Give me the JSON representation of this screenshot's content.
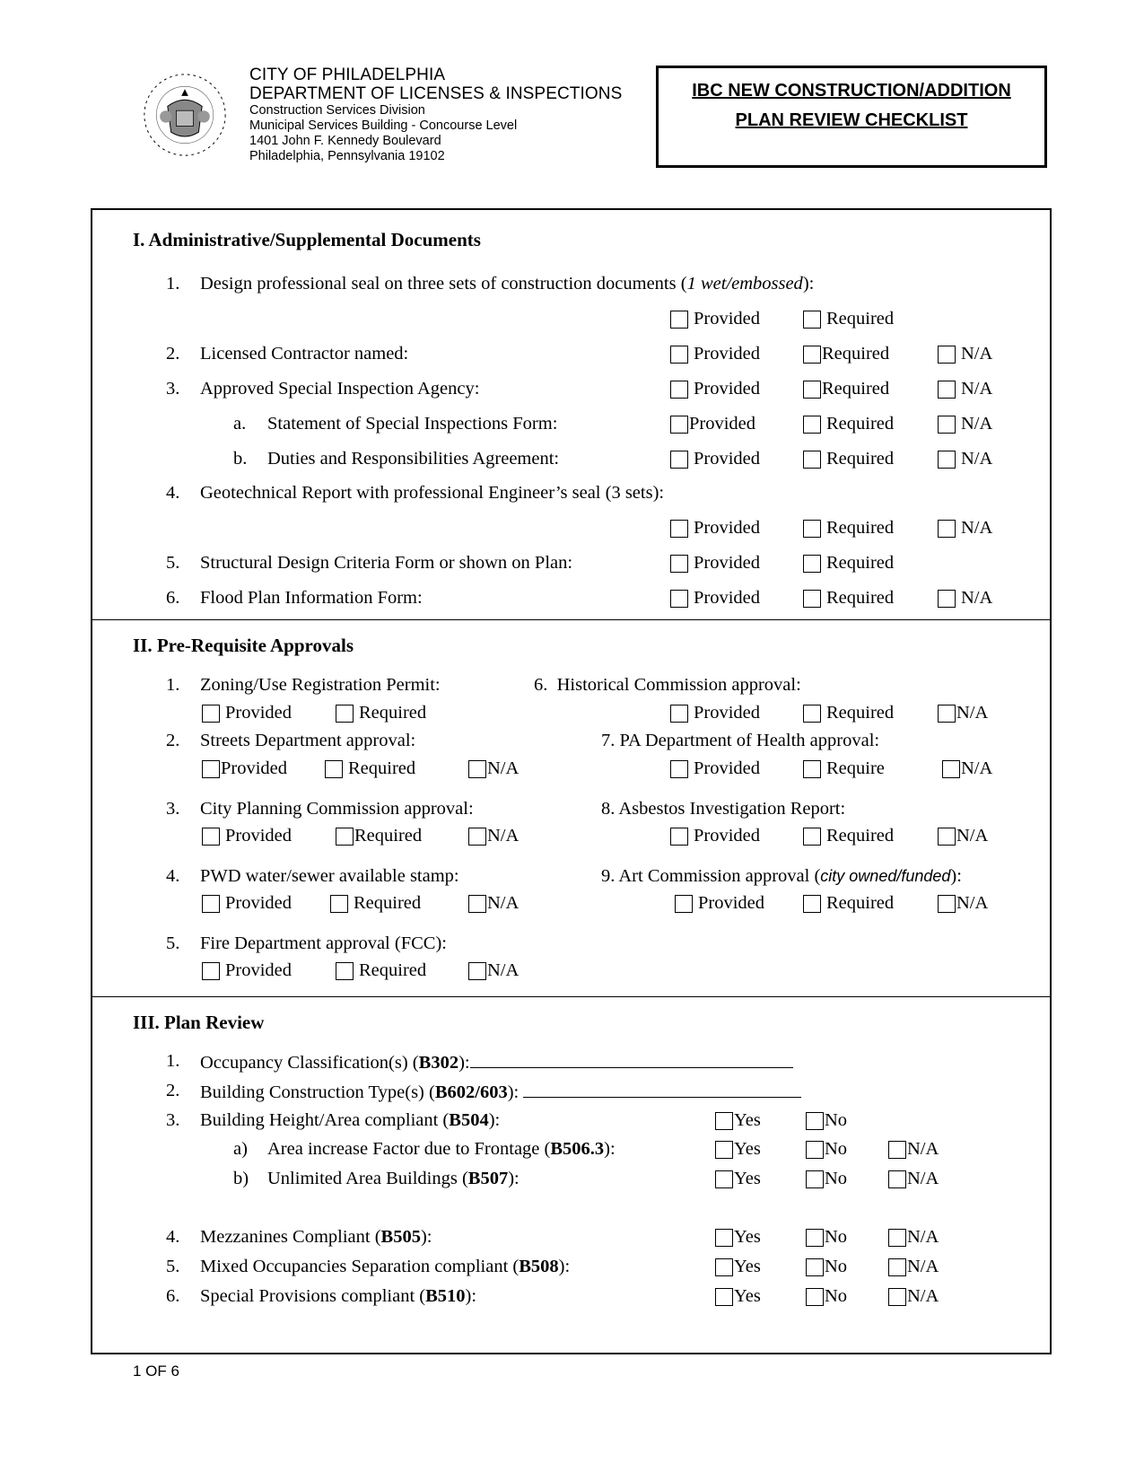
{
  "header": {
    "seal_icon": "city-of-philadelphia-seal",
    "org_lines": [
      "CITY OF PHILADELPHIA",
      "DEPARTMENT OF LICENSES & INSPECTIONS"
    ],
    "address_lines": [
      "Construction Services Division",
      "Municipal Services Building - Concourse Level",
      "1401 John F. Kennedy Boulevard",
      "Philadelphia, Pennsylvania 19102"
    ],
    "title_lines": [
      "IBC NEW CONSTRUCTION/ADDITION",
      "PLAN REVIEW CHECKLIST"
    ]
  },
  "options": {
    "provided": "Provided",
    "required": "Required",
    "require": "Require",
    "na": "N/A",
    "yes": "Yes",
    "no": "No"
  },
  "section1": {
    "title": "I. Administrative/Supplemental Documents",
    "items": [
      {
        "num": "1.",
        "text": "Design professional seal on three sets of construction documents (",
        "italic": "1 wet/embossed",
        "tail": "):"
      },
      {
        "num": "2.",
        "text": "Licensed Contractor named:"
      },
      {
        "num": "3.",
        "text": "Approved Special Inspection Agency:"
      },
      {
        "num": "a.",
        "text": "Statement of Special Inspections Form:"
      },
      {
        "num": "b.",
        "text": "Duties and Responsibilities Agreement:"
      },
      {
        "num": "4.",
        "text": "Geotechnical Report with professional Engineer’s seal (3 sets):"
      },
      {
        "num": "5.",
        "text": "Structural Design Criteria Form or shown on Plan:"
      },
      {
        "num": "6.",
        "text": "Flood Plan Information Form:"
      }
    ]
  },
  "section2": {
    "title": "II. Pre-Requisite Approvals",
    "items": [
      {
        "num": "1.",
        "text": "Zoning/Use Registration Permit:"
      },
      {
        "num": "2.",
        "text": "Streets Department approval:"
      },
      {
        "num": "3.",
        "text": "City Planning Commission approval:"
      },
      {
        "num": "4.",
        "text": "PWD water/sewer available stamp:"
      },
      {
        "num": "5.",
        "text": "Fire Department approval (FCC):"
      },
      {
        "num": "6.",
        "text": "Historical Commission approval:"
      },
      {
        "num": "7.",
        "text": "PA Department of Health approval:"
      },
      {
        "num": "8.",
        "text": "Asbestos Investigation Report:"
      },
      {
        "num": "9.",
        "text": "Art Commission approval (",
        "italic": "city owned/funded",
        "tail": "):"
      }
    ]
  },
  "section3": {
    "title": "III. Plan Review",
    "items": [
      {
        "num": "1.",
        "text": "Occupancy Classification(s) (",
        "bold": "B302",
        "tail": "):",
        "value": ""
      },
      {
        "num": "2.",
        "text": "Building Construction Type(s) (",
        "bold": "B602/603",
        "tail": "): ",
        "value": ""
      },
      {
        "num": "3.",
        "text": "Building Height/Area compliant (",
        "bold": "B504",
        "tail": "):"
      },
      {
        "num": "a)",
        "text": "Area increase Factor due to Frontage (",
        "bold": "B506.3",
        "tail": "):"
      },
      {
        "num": "b)",
        "text": "Unlimited Area Buildings (",
        "bold": "B507",
        "tail": "):"
      },
      {
        "num": "4.",
        "text": "Mezzanines Compliant (",
        "bold": "B505",
        "tail": "):"
      },
      {
        "num": "5.",
        "text": "Mixed Occupancies Separation compliant (",
        "bold": "B508",
        "tail": "):"
      },
      {
        "num": "6.",
        "text": "Special Provisions compliant (",
        "bold": "B510",
        "tail": "):"
      }
    ]
  },
  "footer": {
    "page": "1 OF 6"
  }
}
